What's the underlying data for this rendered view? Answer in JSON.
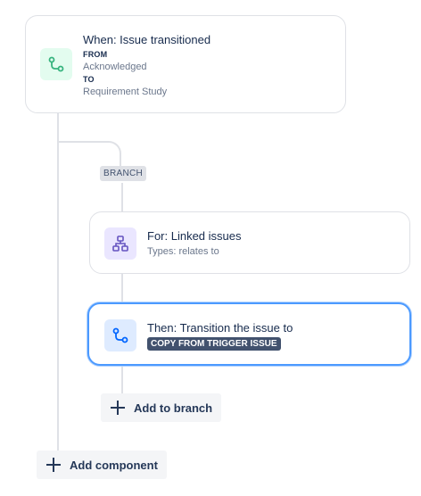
{
  "trigger": {
    "title": "When: Issue transitioned",
    "from_label": "FROM",
    "from_value": "Acknowledged",
    "to_label": "TO",
    "to_value": "Requirement Study",
    "icon": "transition-icon"
  },
  "branch": {
    "tag": "BRANCH",
    "for_card": {
      "title": "For: Linked issues",
      "subtitle": "Types: relates to",
      "icon": "hierarchy-icon"
    },
    "action_card": {
      "title": "Then: Transition the issue to",
      "lozenge": "COPY FROM TRIGGER ISSUE",
      "icon": "transition-icon"
    },
    "add_button": "Add to branch"
  },
  "add_component_button": "Add component",
  "colors": {
    "trigger_icon_bg": "#e3fcef",
    "trigger_icon_fg": "#36b37e",
    "branch_icon_bg": "#eae6ff",
    "branch_icon_fg": "#6554c0",
    "action_icon_bg": "#deebff",
    "action_icon_fg": "#0065ff",
    "selected_border": "#4c9aff"
  }
}
